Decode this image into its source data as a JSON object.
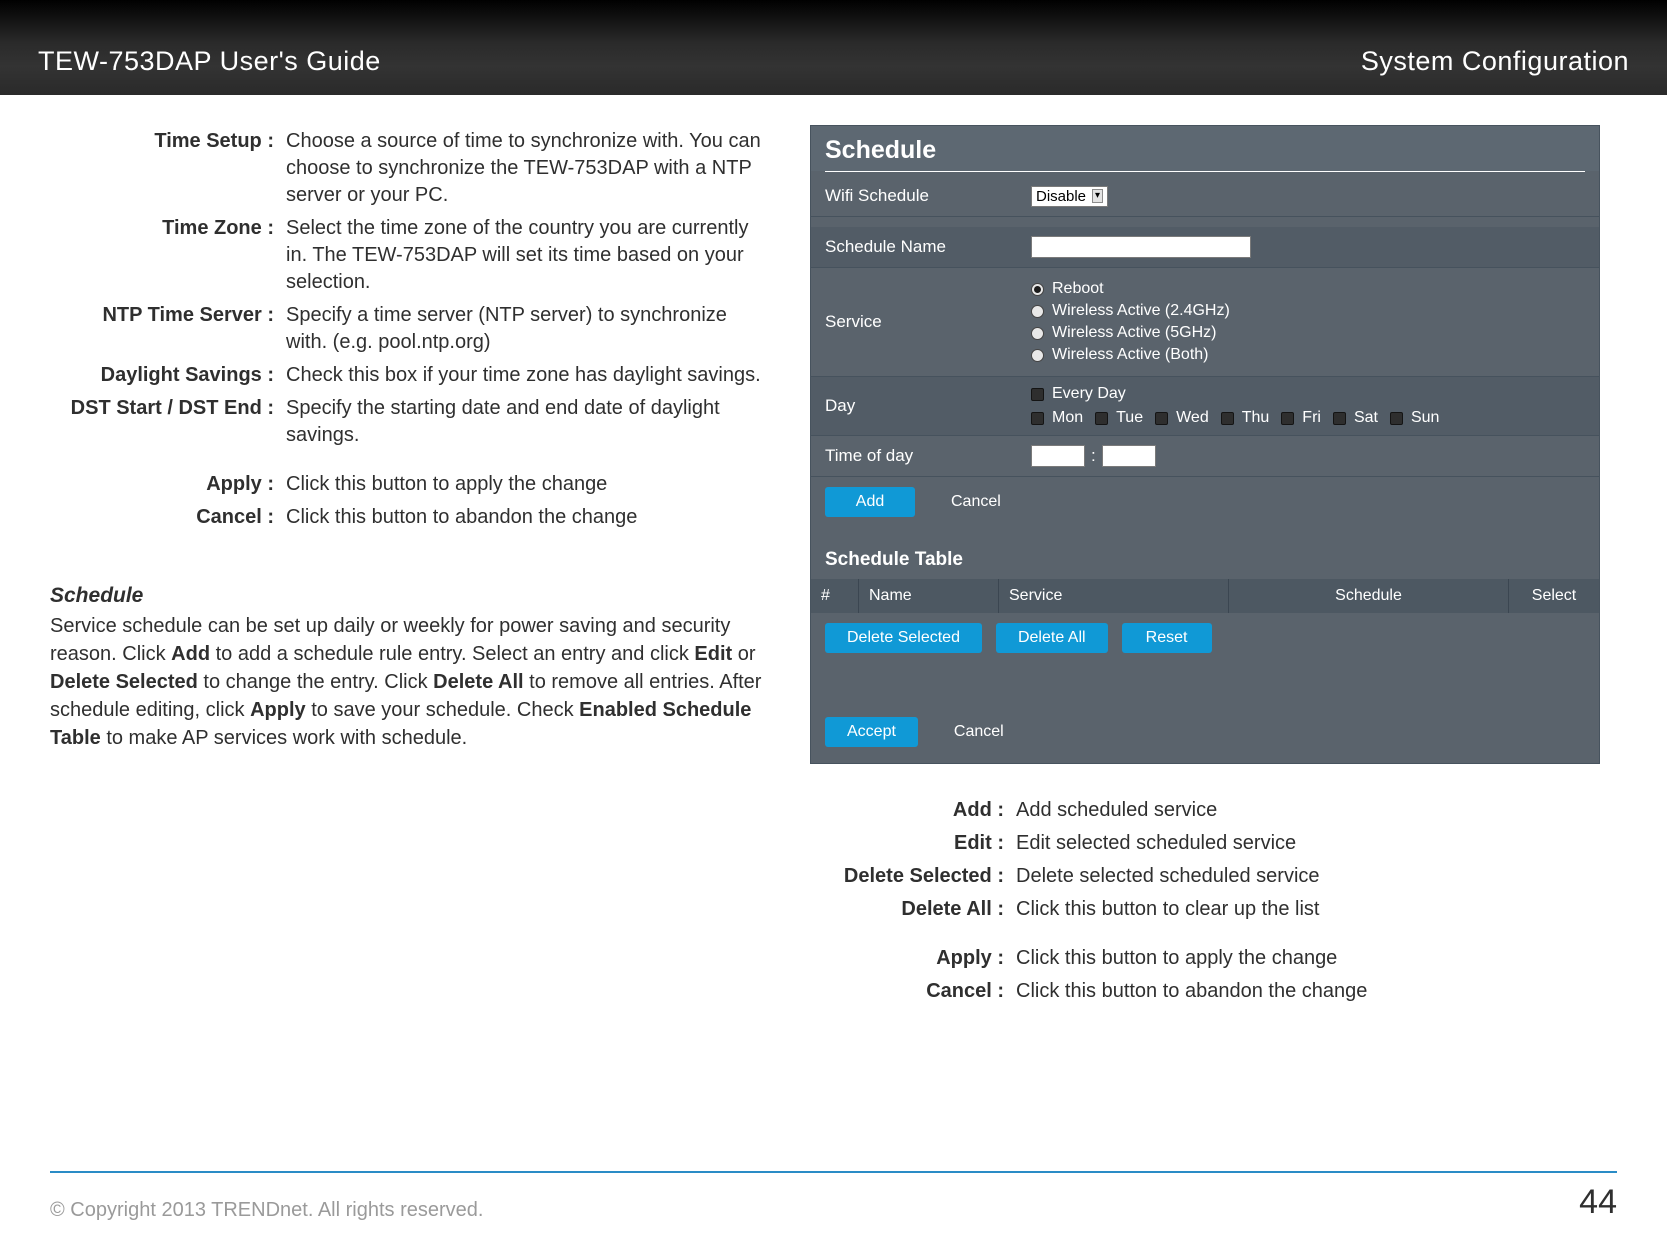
{
  "header": {
    "left": "TEW-753DAP User's Guide",
    "right": "System Configuration"
  },
  "defs_left": [
    {
      "label": "Time Setup :",
      "desc": "Choose a source of time to synchronize with. You can choose to synchronize the TEW-753DAP with a NTP server or your PC."
    },
    {
      "label": "Time Zone :",
      "desc": "Select the time zone of the country you are currently in. The TEW-753DAP will set its time based on your selection."
    },
    {
      "label": "NTP Time Server :",
      "desc": "Specify a time server (NTP server) to synchronize with. (e.g. pool.ntp.org)"
    },
    {
      "label": "Daylight Savings :",
      "desc": "Check this box if your time zone has daylight savings."
    },
    {
      "label": "DST Start / DST End :",
      "desc": "Specify the starting date and end date of daylight savings."
    }
  ],
  "defs_left_actions": [
    {
      "label": "Apply :",
      "desc": "Click this button to apply the change"
    },
    {
      "label": "Cancel :",
      "desc": "Click this button to abandon the change"
    }
  ],
  "section": {
    "heading": "Schedule",
    "body_parts": [
      "Service schedule can be set up daily or weekly for power saving and security reason. Click ",
      "Add",
      " to add a schedule rule entry. Select an entry and click ",
      "Edit",
      " or ",
      "Delete Selected",
      " to change the entry. Click ",
      "Delete All",
      " to remove all entries. After schedule editing, click ",
      "Apply",
      " to save your schedule. Check ",
      "Enabled Schedule Table",
      " to make AP services work with schedule."
    ]
  },
  "ui": {
    "title": "Schedule",
    "wifi_label": "Wifi Schedule",
    "wifi_value": "Disable",
    "schedule_name_label": "Schedule Name",
    "service_label": "Service",
    "services": [
      "Reboot",
      "Wireless Active (2.4GHz)",
      "Wireless Active (5GHz)",
      "Wireless Active (Both)"
    ],
    "day_label": "Day",
    "every_day": "Every Day",
    "days": [
      "Mon",
      "Tue",
      "Wed",
      "Thu",
      "Fri",
      "Sat",
      "Sun"
    ],
    "time_label": "Time of day",
    "colon": ":",
    "buttons_top": {
      "add": "Add",
      "cancel": "Cancel"
    },
    "table_title": "Schedule Table",
    "table_head": {
      "num": "#",
      "name": "Name",
      "service": "Service",
      "schedule": "Schedule",
      "select": "Select"
    },
    "buttons_mid": {
      "deleteSelected": "Delete Selected",
      "deleteAll": "Delete All",
      "reset": "Reset"
    },
    "buttons_bot": {
      "accept": "Accept",
      "cancel": "Cancel"
    }
  },
  "defs_right": [
    {
      "label": "Add :",
      "desc": "Add scheduled service"
    },
    {
      "label": "Edit :",
      "desc": "Edit selected scheduled service"
    },
    {
      "label": "Delete Selected :",
      "desc": "Delete selected scheduled service"
    },
    {
      "label": "Delete All :",
      "desc": "Click this button to clear up the list"
    }
  ],
  "defs_right_actions": [
    {
      "label": "Apply :",
      "desc": "Click this button to apply the change"
    },
    {
      "label": "Cancel :",
      "desc": "Click this button to abandon the change"
    }
  ],
  "footer": {
    "left": "© Copyright 2013 TRENDnet. All rights reserved.",
    "right": "44"
  }
}
